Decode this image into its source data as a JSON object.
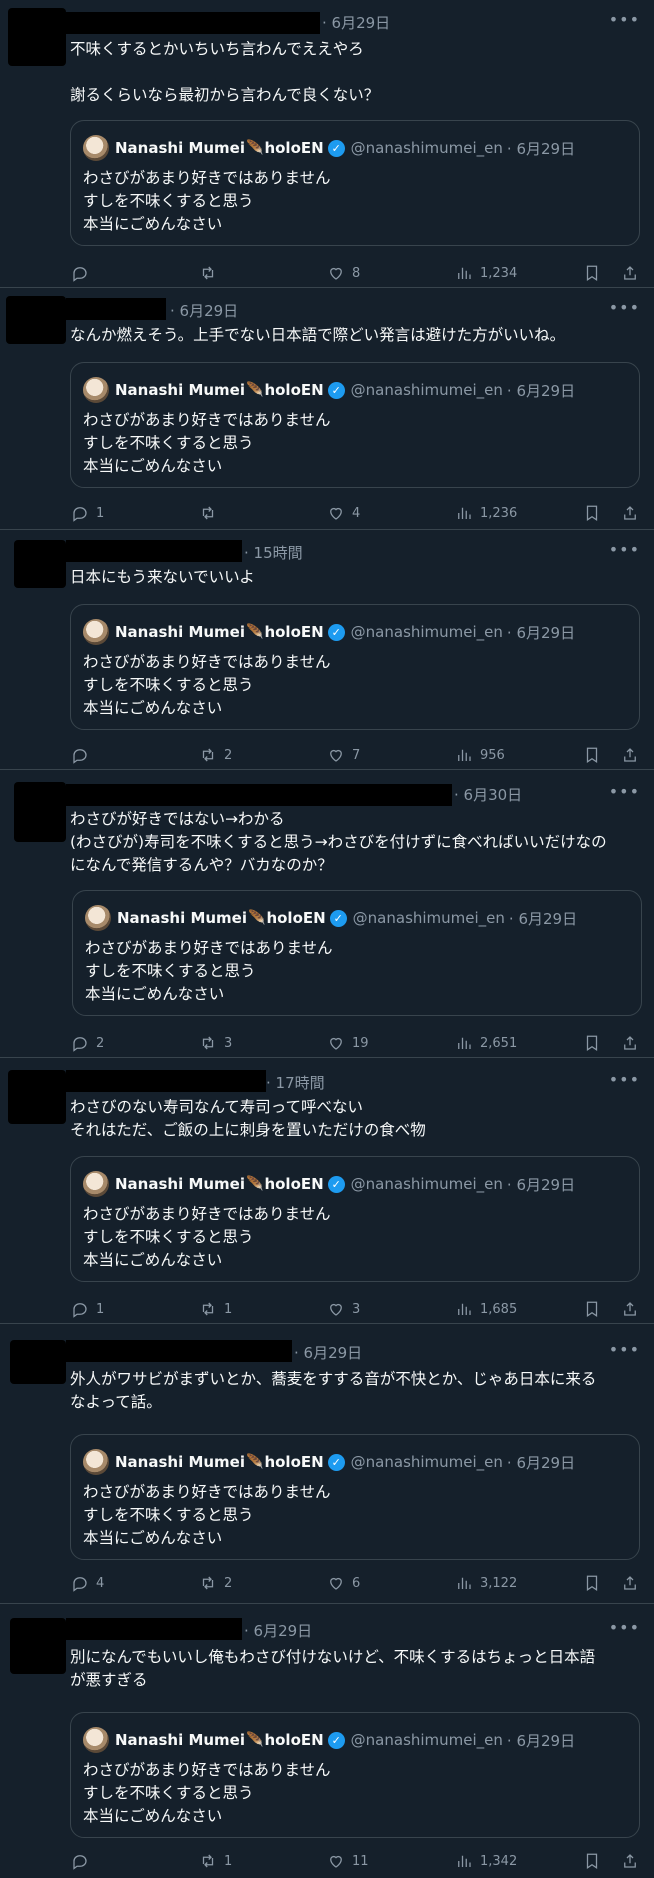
{
  "quoted": {
    "display_name": "Nanashi Mumei",
    "affiliation": "holoEN",
    "handle": "@nanashimumei_en",
    "time": "· 6月29日",
    "text": "わさびがあまり好きではありません\nすしを不味くすると思う\n本当にごめんなさい"
  },
  "icons": {
    "more": "more-icon",
    "reply": "reply-icon",
    "retweet": "retweet-icon",
    "like": "like-icon",
    "views": "views-icon",
    "bookmark": "bookmark-icon",
    "share": "share-icon",
    "verified": "verified-badge-icon",
    "feather": "feather-icon"
  },
  "colors": {
    "background": "#15202b",
    "text": "#f7f9f9",
    "muted": "#8b98a5",
    "border": "#38444d",
    "verified": "#1d9bf0"
  },
  "tweets": [
    {
      "time": "· 6月29日",
      "text": "不味くするとかいちいち言わんでええやろ\n\n謝るくらいなら最初から言わんで良くない？",
      "replies": "",
      "retweets": "",
      "likes": "8",
      "views": "1,234"
    },
    {
      "time": "· 6月29日",
      "text": "なんか燃えそう。上手でない日本語で際どい発言は避けた方がいいね。",
      "replies": "1",
      "retweets": "",
      "likes": "4",
      "views": "1,236"
    },
    {
      "time": "· 15時間",
      "text": "日本にもう来ないでいいよ",
      "replies": "",
      "retweets": "2",
      "likes": "7",
      "views": "956"
    },
    {
      "time": "· 6月30日",
      "text": "わさびが好きではない→わかる\n(わさびが)寿司を不味くすると思う→わさびを付けずに食べればいいだけなの\nになんで発信するんや？バカなのか？",
      "replies": "2",
      "retweets": "3",
      "likes": "19",
      "views": "2,651"
    },
    {
      "time": "· 17時間",
      "text": "わさびのない寿司なんて寿司って呼べない\nそれはただ、ご飯の上に刺身を置いただけの食べ物",
      "replies": "1",
      "retweets": "1",
      "likes": "3",
      "views": "1,685"
    },
    {
      "time": "· 6月29日",
      "text": "外人がワサビがまずいとか、蕎麦をすする音が不快とか、じゃあ日本に来る\nなよって話。",
      "replies": "4",
      "retweets": "2",
      "likes": "6",
      "views": "3,122"
    },
    {
      "time": "· 6月29日",
      "text": "別になんでもいいし俺もわさび付けないけど、不味くするはちょっと日本語\nが悪すぎる",
      "replies": "",
      "retweets": "1",
      "likes": "11",
      "views": "1,342"
    }
  ]
}
